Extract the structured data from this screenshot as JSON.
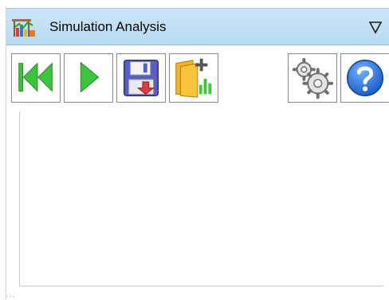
{
  "window": {
    "title": "Simulation Analysis",
    "title_icon": "simulation-analysis-app-icon",
    "menu_icon": "dropdown-triangle-icon"
  },
  "toolbar": {
    "buttons": [
      {
        "name": "rewind",
        "icon": "rewind-to-start-icon"
      },
      {
        "name": "play",
        "icon": "play-icon"
      },
      {
        "name": "save",
        "icon": "save-floppy-icon"
      },
      {
        "name": "open-folder",
        "icon": "open-folder-icon"
      },
      {
        "name": "settings",
        "icon": "gears-icon"
      },
      {
        "name": "help",
        "icon": "help-question-icon"
      }
    ]
  },
  "plot": {
    "empty": true
  },
  "colors": {
    "titlebar": "#c8e6f8",
    "play_green": "#3cc43c",
    "help_blue": "#1d6fd6"
  }
}
